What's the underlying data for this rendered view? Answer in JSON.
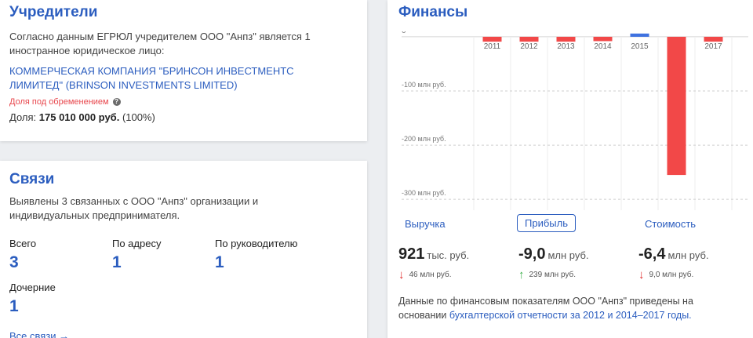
{
  "founders": {
    "title": "Учредители",
    "desc_line1": "Согласно данным ЕГРЮЛ учредителем ООО \"Анпз\" является 1",
    "desc_line2": "иностранное юридическое лицо:",
    "company_line1": "КОММЕРЧЕСКАЯ КОМПАНИЯ \"БРИНСОН ИНВЕСТМЕНТС",
    "company_line2": "ЛИМИТЕД\" (BRINSON INVESTMENTS LIMITED)",
    "encumbrance": "Доля под обременением",
    "share_prefix": "Доля:",
    "share_amount": "175 010 000 руб.",
    "share_percent": "(100%)"
  },
  "links": {
    "title": "Связи",
    "desc_line1": "Выявлены 3 связанных с ООО \"Анпз\" организации и",
    "desc_line2": "индивидуальных предпринимателя.",
    "total_label": "Всего",
    "total_value": "3",
    "address_label": "По адресу",
    "address_value": "1",
    "manager_label": "По руководителю",
    "manager_value": "1",
    "subsidiary_label": "Дочерние",
    "subsidiary_value": "1",
    "all_links": "Все связи →"
  },
  "finance": {
    "title": "Финансы",
    "tabs": {
      "revenue": "Выручка",
      "profit": "Прибыль",
      "value": "Стоимость"
    },
    "revenue": {
      "value": "921",
      "unit": "тыс. руб.",
      "delta": "46 млн руб."
    },
    "profit": {
      "value": "-9,0",
      "unit": "млн руб.",
      "delta": "239 млн руб."
    },
    "cost": {
      "value": "-6,4",
      "unit": "млн руб.",
      "delta": "9,0 млн руб."
    },
    "footnote_prefix": "Данные по финансовым показателям ООО \"Анпз\" приведены на",
    "footnote_mid": "основании",
    "footnote_link": "бухгалтерской отчетности за 2012 и 2014–2017 годы.",
    "colors": {
      "positive": "#3f72e0",
      "negative": "#f24848",
      "accent": "#2b5dbf"
    }
  },
  "chart_data": {
    "type": "bar",
    "categories": [
      "2011",
      "2012",
      "2013",
      "2014",
      "2015",
      "2016",
      "2017"
    ],
    "values": [
      -9,
      -9,
      -9,
      -8,
      6,
      -255,
      -9
    ],
    "unit": "млн руб.",
    "ylim": [
      -320,
      10
    ],
    "yticks": [
      {
        "value": 0,
        "label": "0"
      },
      {
        "value": -100,
        "label": "-100 млн руб."
      },
      {
        "value": -200,
        "label": "-200 млн руб."
      },
      {
        "value": -300,
        "label": "-300 млн руб."
      }
    ],
    "grid": true
  }
}
